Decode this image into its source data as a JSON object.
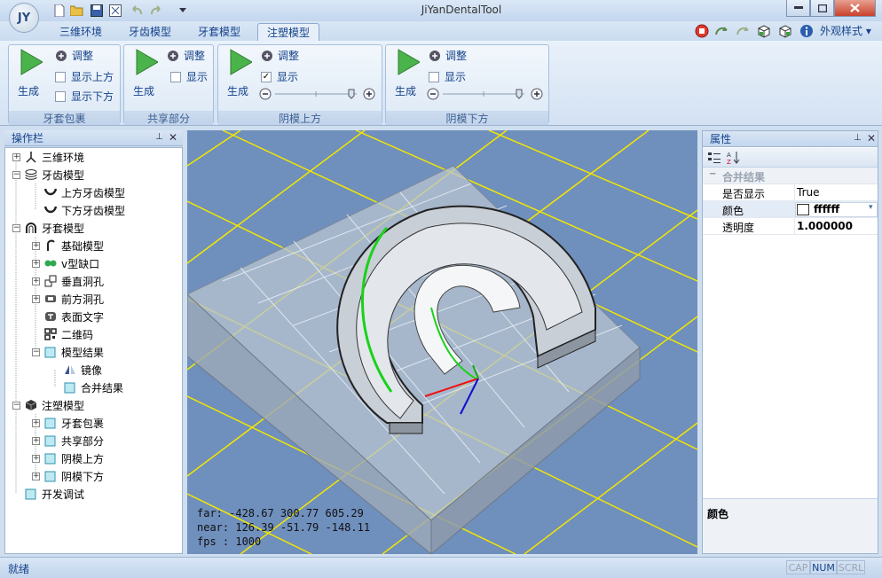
{
  "window": {
    "title": "JiYanDentalTool",
    "logo": "JY"
  },
  "tabs": [
    {
      "label": "三维环境"
    },
    {
      "label": "牙齿模型"
    },
    {
      "label": "牙套模型"
    },
    {
      "label": "注塑模型"
    }
  ],
  "style_label": "外观样式",
  "groups": [
    {
      "title": "牙套包裹",
      "gen": "生成",
      "adjust": "调整",
      "checks": [
        {
          "label": "显示上方",
          "checked": false
        },
        {
          "label": "显示下方",
          "checked": false
        }
      ]
    },
    {
      "title": "共享部分",
      "gen": "生成",
      "adjust": "调整",
      "checks": [
        {
          "label": "显示",
          "checked": false
        }
      ]
    },
    {
      "title": "阴模上方",
      "gen": "生成",
      "adjust": "调整",
      "checks": [
        {
          "label": "显示",
          "checked": true
        }
      ],
      "slider": 0.9
    },
    {
      "title": "阴模下方",
      "gen": "生成",
      "adjust": "调整",
      "checks": [
        {
          "label": "显示",
          "checked": false
        }
      ],
      "slider": 0.9
    }
  ],
  "ops_panel": {
    "title": "操作栏"
  },
  "tree": [
    {
      "label": "三维环境",
      "icon": "axes-icon"
    },
    {
      "label": "牙齿模型",
      "icon": "stack-icon"
    },
    {
      "label": "上方牙齿模型",
      "icon": "tooth-icon"
    },
    {
      "label": "下方牙齿模型",
      "icon": "tooth-icon"
    },
    {
      "label": "牙套模型",
      "icon": "arch-icon"
    },
    {
      "label": "基础模型",
      "icon": "base-model-icon"
    },
    {
      "label": "v型缺口",
      "icon": "v-notch-icon"
    },
    {
      "label": "垂直洞孔",
      "icon": "vertical-hole-icon"
    },
    {
      "label": "前方洞孔",
      "icon": "front-hole-icon"
    },
    {
      "label": "表面文字",
      "icon": "text-icon"
    },
    {
      "label": "二维码",
      "icon": "qr-icon"
    },
    {
      "label": "模型结果",
      "icon": "cube-icon"
    },
    {
      "label": "镜像",
      "icon": "mirror-icon"
    },
    {
      "label": "合并结果",
      "icon": "cube-icon"
    },
    {
      "label": "注塑模型",
      "icon": "mold-icon"
    },
    {
      "label": "牙套包裹",
      "icon": "cube-icon"
    },
    {
      "label": "共享部分",
      "icon": "cube-icon"
    },
    {
      "label": "阴模上方",
      "icon": "cube-icon"
    },
    {
      "label": "阴模下方",
      "icon": "cube-icon"
    },
    {
      "label": "开发调试",
      "icon": "cube-icon"
    }
  ],
  "viewport": {
    "far": "far: -428.67 300.77 605.29",
    "near": "near: 126.39 -51.79 -148.11",
    "fps": "fps : 1000"
  },
  "props_panel": {
    "title": "属性",
    "category": "合并结果",
    "rows": [
      {
        "name": "是否显示",
        "value": "True"
      },
      {
        "name": "颜色",
        "value": "ffffff"
      },
      {
        "name": "透明度",
        "value": "1.000000"
      }
    ],
    "desc_title": "颜色"
  },
  "status": {
    "text": "就绪",
    "cap": "CAP",
    "num": "NUM",
    "scrl": "SCRL"
  },
  "colors": {
    "ribbon_text": "#15428b",
    "viewport_bg": "#6f8fbd",
    "grid": "#f2e600"
  }
}
